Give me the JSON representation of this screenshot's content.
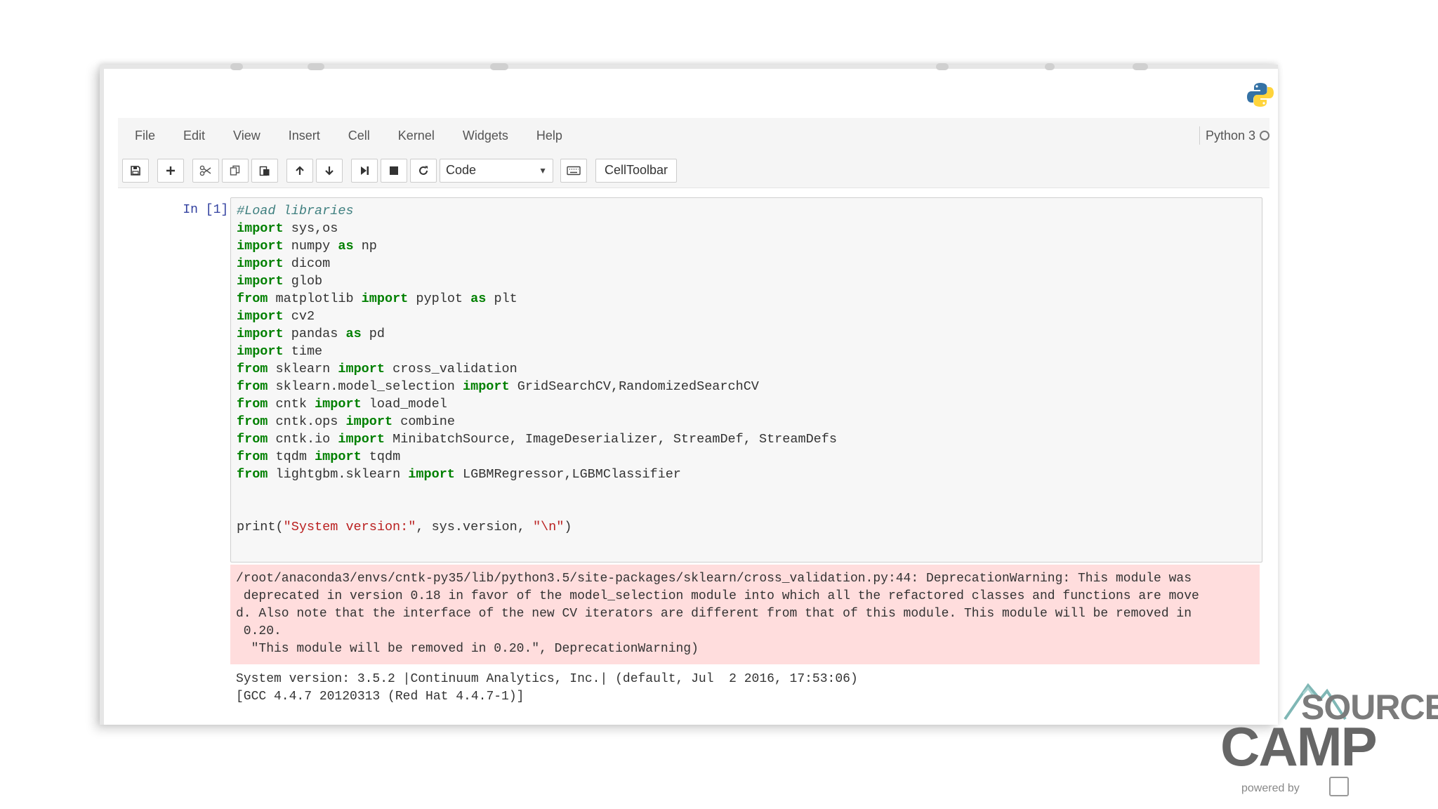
{
  "menu": {
    "items": [
      "File",
      "Edit",
      "View",
      "Insert",
      "Cell",
      "Kernel",
      "Widgets",
      "Help"
    ],
    "kernel_name": "Python 3"
  },
  "toolbar": {
    "cell_type": "Code",
    "celltoolbar_label": "CellToolbar",
    "icons": [
      "save-icon",
      "plus-icon",
      "scissors-icon",
      "copy-icon",
      "paste-icon",
      "arrow-up-icon",
      "arrow-down-icon",
      "step-forward-icon",
      "stop-icon",
      "restart-icon",
      "keyboard-icon"
    ]
  },
  "cell": {
    "prompt": "In [1]:",
    "code_lines": [
      "#Load libraries",
      "import sys,os",
      "import numpy as np",
      "import dicom",
      "import glob",
      "from matplotlib import pyplot as plt",
      "import cv2",
      "import pandas as pd",
      "import time",
      "from sklearn import cross_validation",
      "from sklearn.model_selection import GridSearchCV,RandomizedSearchCV",
      "from cntk import load_model",
      "from cntk.ops import combine",
      "from cntk.io import MinibatchSource, ImageDeserializer, StreamDef, StreamDefs",
      "from tqdm import tqdm",
      "from lightgbm.sklearn import LGBMRegressor,LGBMClassifier",
      "",
      "",
      "print(\"System version:\", sys.version, \"\\n\")"
    ],
    "stderr_lines": [
      "/root/anaconda3/envs/cntk-py35/lib/python3.5/site-packages/sklearn/cross_validation.py:44: DeprecationWarning: This module was",
      " deprecated in version 0.18 in favor of the model_selection module into which all the refactored classes and functions are move",
      "d. Also note that the interface of the new CV iterators are different from that of this module. This module will be removed in",
      " 0.20.",
      "  \"This module will be removed in 0.20.\", DeprecationWarning)"
    ],
    "stdout_lines": [
      "System version: 3.5.2 |Continuum Analytics, Inc.| (default, Jul  2 2016, 17:53:06)",
      "[GCC 4.4.7 20120313 (Red Hat 4.4.7-1)]"
    ]
  },
  "watermark": {
    "line1": "SOURCE",
    "line2": "CAMP",
    "powered_by": "powered by"
  },
  "colors": {
    "keyword": "#008000",
    "comment": "#408080",
    "string": "#ba2121",
    "stderr_bg": "#ffdddd",
    "prompt": "#303f9f"
  }
}
